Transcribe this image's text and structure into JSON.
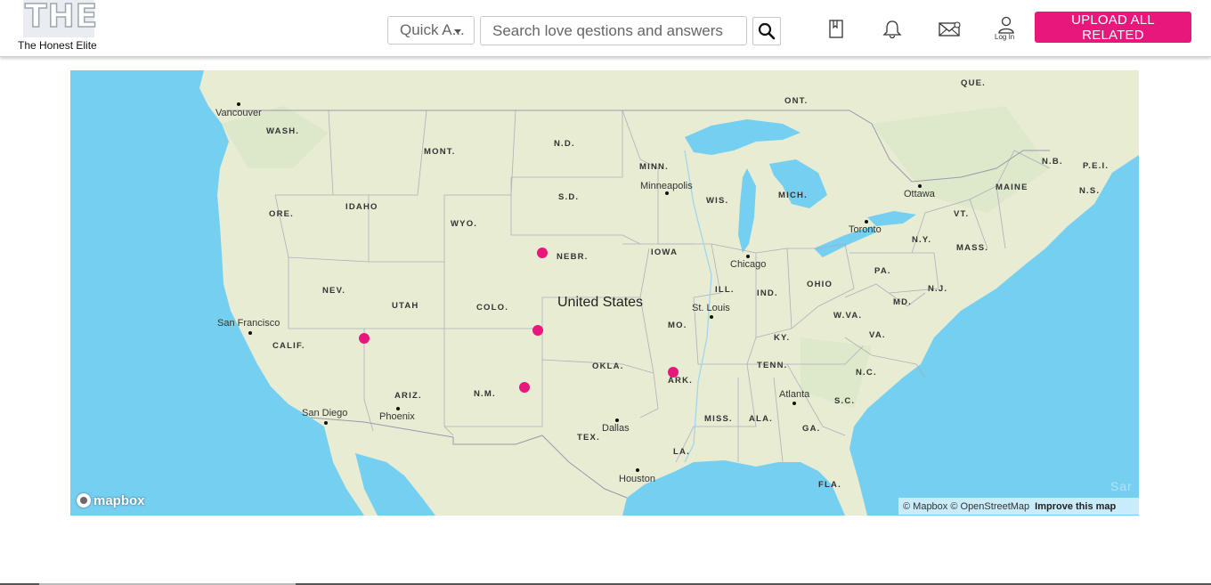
{
  "header": {
    "logo_mark": "THE",
    "logo_text": "The Honest Elite",
    "quick_select": "Quick A...",
    "search_placeholder": "Search love qestions and answers",
    "login_label": "Log In",
    "upload_label": "UPLOAD ALL RELATED"
  },
  "map": {
    "country_label": "United States",
    "states": [
      {
        "name": "WASH."
      },
      {
        "name": "ORE."
      },
      {
        "name": "IDAHO"
      },
      {
        "name": "MONT."
      },
      {
        "name": "WYO."
      },
      {
        "name": "N.D."
      },
      {
        "name": "S.D."
      },
      {
        "name": "NEBR."
      },
      {
        "name": "NEV."
      },
      {
        "name": "UTAH"
      },
      {
        "name": "COLO."
      },
      {
        "name": "CALIF."
      },
      {
        "name": "ARIZ."
      },
      {
        "name": "N.M."
      },
      {
        "name": "TEX."
      },
      {
        "name": "OKLA."
      },
      {
        "name": "MINN."
      },
      {
        "name": "IOWA"
      },
      {
        "name": "MO."
      },
      {
        "name": "ARK."
      },
      {
        "name": "LA."
      },
      {
        "name": "WIS."
      },
      {
        "name": "ILL."
      },
      {
        "name": "MICH."
      },
      {
        "name": "IND."
      },
      {
        "name": "OHIO"
      },
      {
        "name": "KY."
      },
      {
        "name": "TENN."
      },
      {
        "name": "MISS."
      },
      {
        "name": "ALA."
      },
      {
        "name": "GA."
      },
      {
        "name": "FLA."
      },
      {
        "name": "S.C."
      },
      {
        "name": "N.C."
      },
      {
        "name": "VA."
      },
      {
        "name": "W.VA."
      },
      {
        "name": "PA."
      },
      {
        "name": "N.Y."
      },
      {
        "name": "MD."
      },
      {
        "name": "N.J."
      },
      {
        "name": "MASS."
      },
      {
        "name": "VT."
      },
      {
        "name": "MAINE"
      },
      {
        "name": "N.B."
      },
      {
        "name": "P.E.I."
      },
      {
        "name": "N.S."
      },
      {
        "name": "ONT."
      },
      {
        "name": "QUE."
      }
    ],
    "cities": [
      {
        "name": "Vancouver"
      },
      {
        "name": "San Francisco"
      },
      {
        "name": "San Diego"
      },
      {
        "name": "Phoenix"
      },
      {
        "name": "Dallas"
      },
      {
        "name": "Houston"
      },
      {
        "name": "Minneapolis"
      },
      {
        "name": "Chicago"
      },
      {
        "name": "St. Louis"
      },
      {
        "name": "Atlanta"
      },
      {
        "name": "Toronto"
      },
      {
        "name": "Ottawa"
      }
    ],
    "sea_label": "Sar",
    "markers_count": 5,
    "mapbox_logo": "mapbox",
    "attribution": "© Mapbox © OpenStreetMap",
    "improve_link": "Improve this map"
  }
}
